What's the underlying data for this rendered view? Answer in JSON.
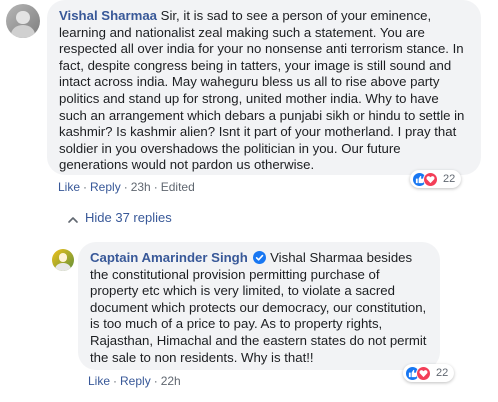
{
  "comment": {
    "author": "Vishal Sharmaa",
    "text": "Sir, it is sad to see a person of your eminence, learning and nationalist zeal making such a statement. You are respected all over india for your no nonsense anti terrorism stance. In fact, despite congress being in tatters, your image is still sound and intact across india. May waheguru bless us all to rise above party politics and stand up for strong, united mother india. Why to have such an arrangement which debars a punjabi sikh or hindu to settle in kashmir? Is kashmir alien? Isnt it part of your motherland. I pray that soldier in you overshadows the politician in you. Our future generations would not pardon us otherwise.",
    "like_label": "Like",
    "reply_label": "Reply",
    "time": "23h",
    "edited": "Edited",
    "reaction_count": "22"
  },
  "replies_toggle": {
    "label": "Hide 37 replies"
  },
  "reply": {
    "author": "Captain Amarinder Singh",
    "text": "Vishal Sharmaa besides the constitutional provision permitting purchase of property etc which is very limited, to violate a sacred document which protects our democracy, our constitution, is too much of a price to pay. As to property rights, Rajasthan, Himachal and the eastern states do not permit the sale to non residents. Why is that!!",
    "like_label": "Like",
    "reply_label": "Reply",
    "time": "22h",
    "reaction_count": "22"
  },
  "colors": {
    "link": "#385898",
    "bubble": "#f2f3f5",
    "like": "#1877f2",
    "love": "#f33e58"
  },
  "icons": [
    "like-reaction-icon",
    "love-reaction-icon",
    "chevron-up-icon",
    "verified-badge-icon"
  ]
}
